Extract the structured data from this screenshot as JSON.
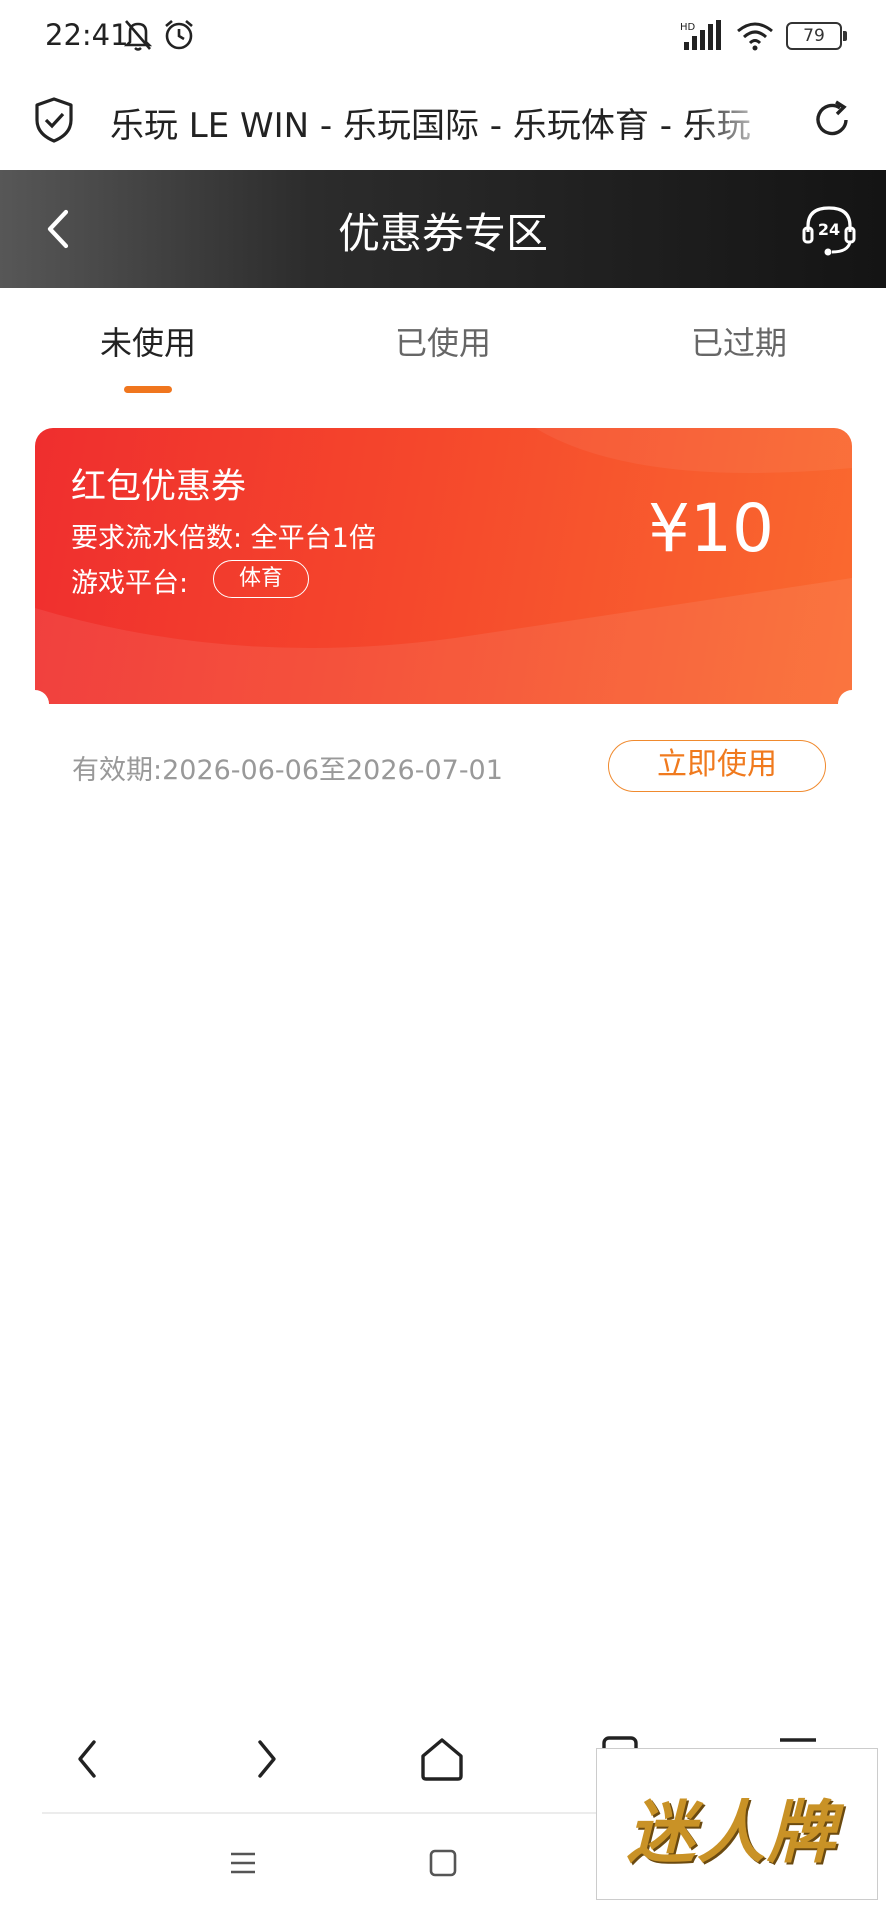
{
  "status_bar": {
    "time": "22:41",
    "battery": "79",
    "network_label": "HD",
    "icons": [
      "mute-bell-icon",
      "alarm-icon",
      "signal-icon",
      "wifi-icon",
      "battery-icon"
    ]
  },
  "browser": {
    "page_title": "乐玩 LE WIN - 乐玩国际 - 乐玩体育 - 乐玩"
  },
  "header": {
    "title": "优惠券专区"
  },
  "tabs": [
    {
      "label": "未使用",
      "active": true
    },
    {
      "label": "已使用",
      "active": false
    },
    {
      "label": "已过期",
      "active": false
    }
  ],
  "coupon": {
    "name": "红包优惠券",
    "requirement": "要求流水倍数: 全平台1倍",
    "platform_label": "游戏平台:",
    "platform_tag": "体育",
    "amount": "¥10",
    "validity": "有效期:2026-06-06至2026-07-01",
    "use_button": "立即使用"
  },
  "watermark": {
    "text": "迷人牌"
  },
  "colors": {
    "accent": "#f0761e",
    "coupon_start": "#ef2e2e",
    "coupon_end": "#fa6a2f",
    "header_dark": "#141414"
  }
}
